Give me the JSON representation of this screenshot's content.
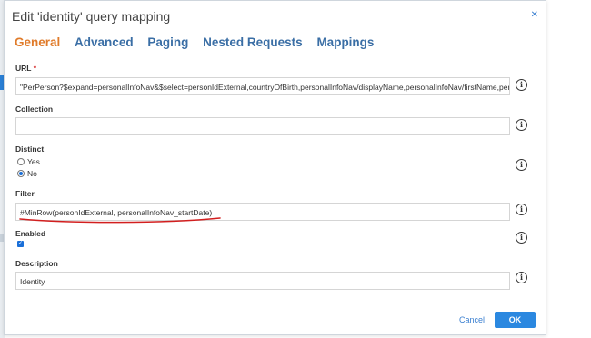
{
  "dialog": {
    "title": "Edit 'identity' query mapping",
    "close_icon": "close-icon"
  },
  "tabs": [
    {
      "label": "General",
      "active": true
    },
    {
      "label": "Advanced",
      "active": false
    },
    {
      "label": "Paging",
      "active": false
    },
    {
      "label": "Nested Requests",
      "active": false
    },
    {
      "label": "Mappings",
      "active": false
    }
  ],
  "fields": {
    "url": {
      "label": "URL",
      "required_mark": "*",
      "value": "\"PerPerson?$expand=personalInfoNav&$select=personIdExternal,countryOfBirth,personalInfoNav/displayName,personalInfoNav/firstName,personalInfoNav/lastName"
    },
    "collection": {
      "label": "Collection",
      "value": ""
    },
    "distinct": {
      "label": "Distinct",
      "options": [
        "Yes",
        "No"
      ],
      "selected": "No"
    },
    "filter": {
      "label": "Filter",
      "value": "#MinRow(personIdExternal, personalInfoNav_startDate)"
    },
    "enabled": {
      "label": "Enabled",
      "checked": true
    },
    "description": {
      "label": "Description",
      "value": "Identity"
    }
  },
  "buttons": {
    "cancel": "Cancel",
    "ok": "OK"
  },
  "info_glyph": "i",
  "colors": {
    "active_tab": "#e07b2a",
    "tab": "#3a6ea5",
    "primary_button": "#2b88e0",
    "annotation": "#d21f1f"
  }
}
